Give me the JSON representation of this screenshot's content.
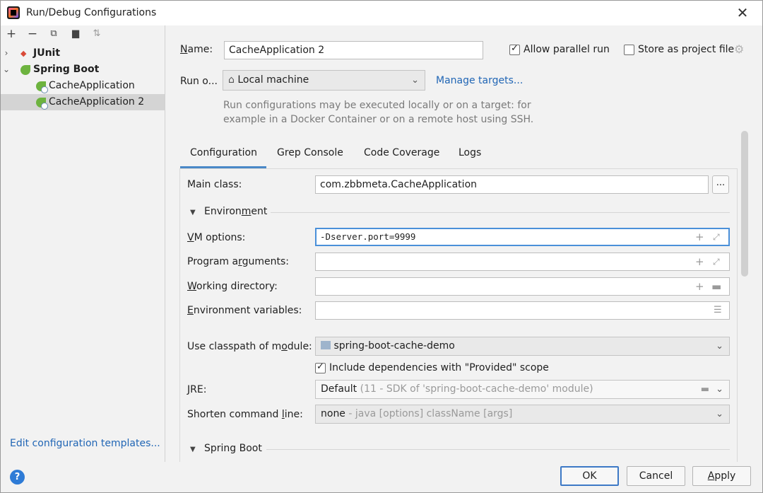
{
  "window": {
    "title": "Run/Debug Configurations"
  },
  "left": {
    "toolbar": [
      "add-icon",
      "remove-icon",
      "copy-icon",
      "folder-icon",
      "sort-icon"
    ],
    "tree": [
      {
        "label": "JUnit",
        "bold": true,
        "expanded": false
      },
      {
        "label": "Spring Boot",
        "bold": true,
        "expanded": true
      },
      {
        "label": "CacheApplication",
        "bold": false
      },
      {
        "label": "CacheApplication 2",
        "bold": false,
        "selected": true
      }
    ],
    "edit_templates": "Edit configuration templates..."
  },
  "form": {
    "name_label": "Name:",
    "name_value": "CacheApplication 2",
    "allow_parallel": "Allow parallel run",
    "allow_parallel_checked": true,
    "store_project": "Store as project file",
    "store_project_checked": false,
    "run_on_label": "Run o...",
    "run_on_value": "Local machine",
    "manage_targets": "Manage targets...",
    "hint_line1": "Run configurations may be executed locally or on a target: for",
    "hint_line2": "example in a Docker Container or on a remote host using SSH."
  },
  "tabs": [
    "Configuration",
    "Grep Console",
    "Code Coverage",
    "Logs"
  ],
  "config": {
    "main_class_label": "Main class:",
    "main_class_value": "com.zbbmeta.CacheApplication",
    "browse": "...",
    "environment_section": "Environment",
    "vm_options_label": "VM options:",
    "vm_options_value": "-Dserver.port=9999",
    "program_args_label": "Program arguments:",
    "working_dir_label": "Working directory:",
    "env_vars_label": "Environment variables:",
    "classpath_label": "Use classpath of module:",
    "classpath_value": "spring-boot-cache-demo",
    "include_deps": "Include dependencies with \"Provided\" scope",
    "include_deps_checked": true,
    "jre_label": "JRE:",
    "jre_value": "Default",
    "jre_hint": "(11 - SDK of 'spring-boot-cache-demo' module)",
    "shorten_label": "Shorten command line:",
    "shorten_value": "none",
    "shorten_hint": "- java [options] className [args]",
    "spring_boot_section": "Spring Boot"
  },
  "buttons": {
    "ok": "OK",
    "cancel": "Cancel",
    "apply": "Apply"
  },
  "colors": {
    "accent": "#4a88c7",
    "link": "#2166b5",
    "selection": "#d4d4d4"
  }
}
